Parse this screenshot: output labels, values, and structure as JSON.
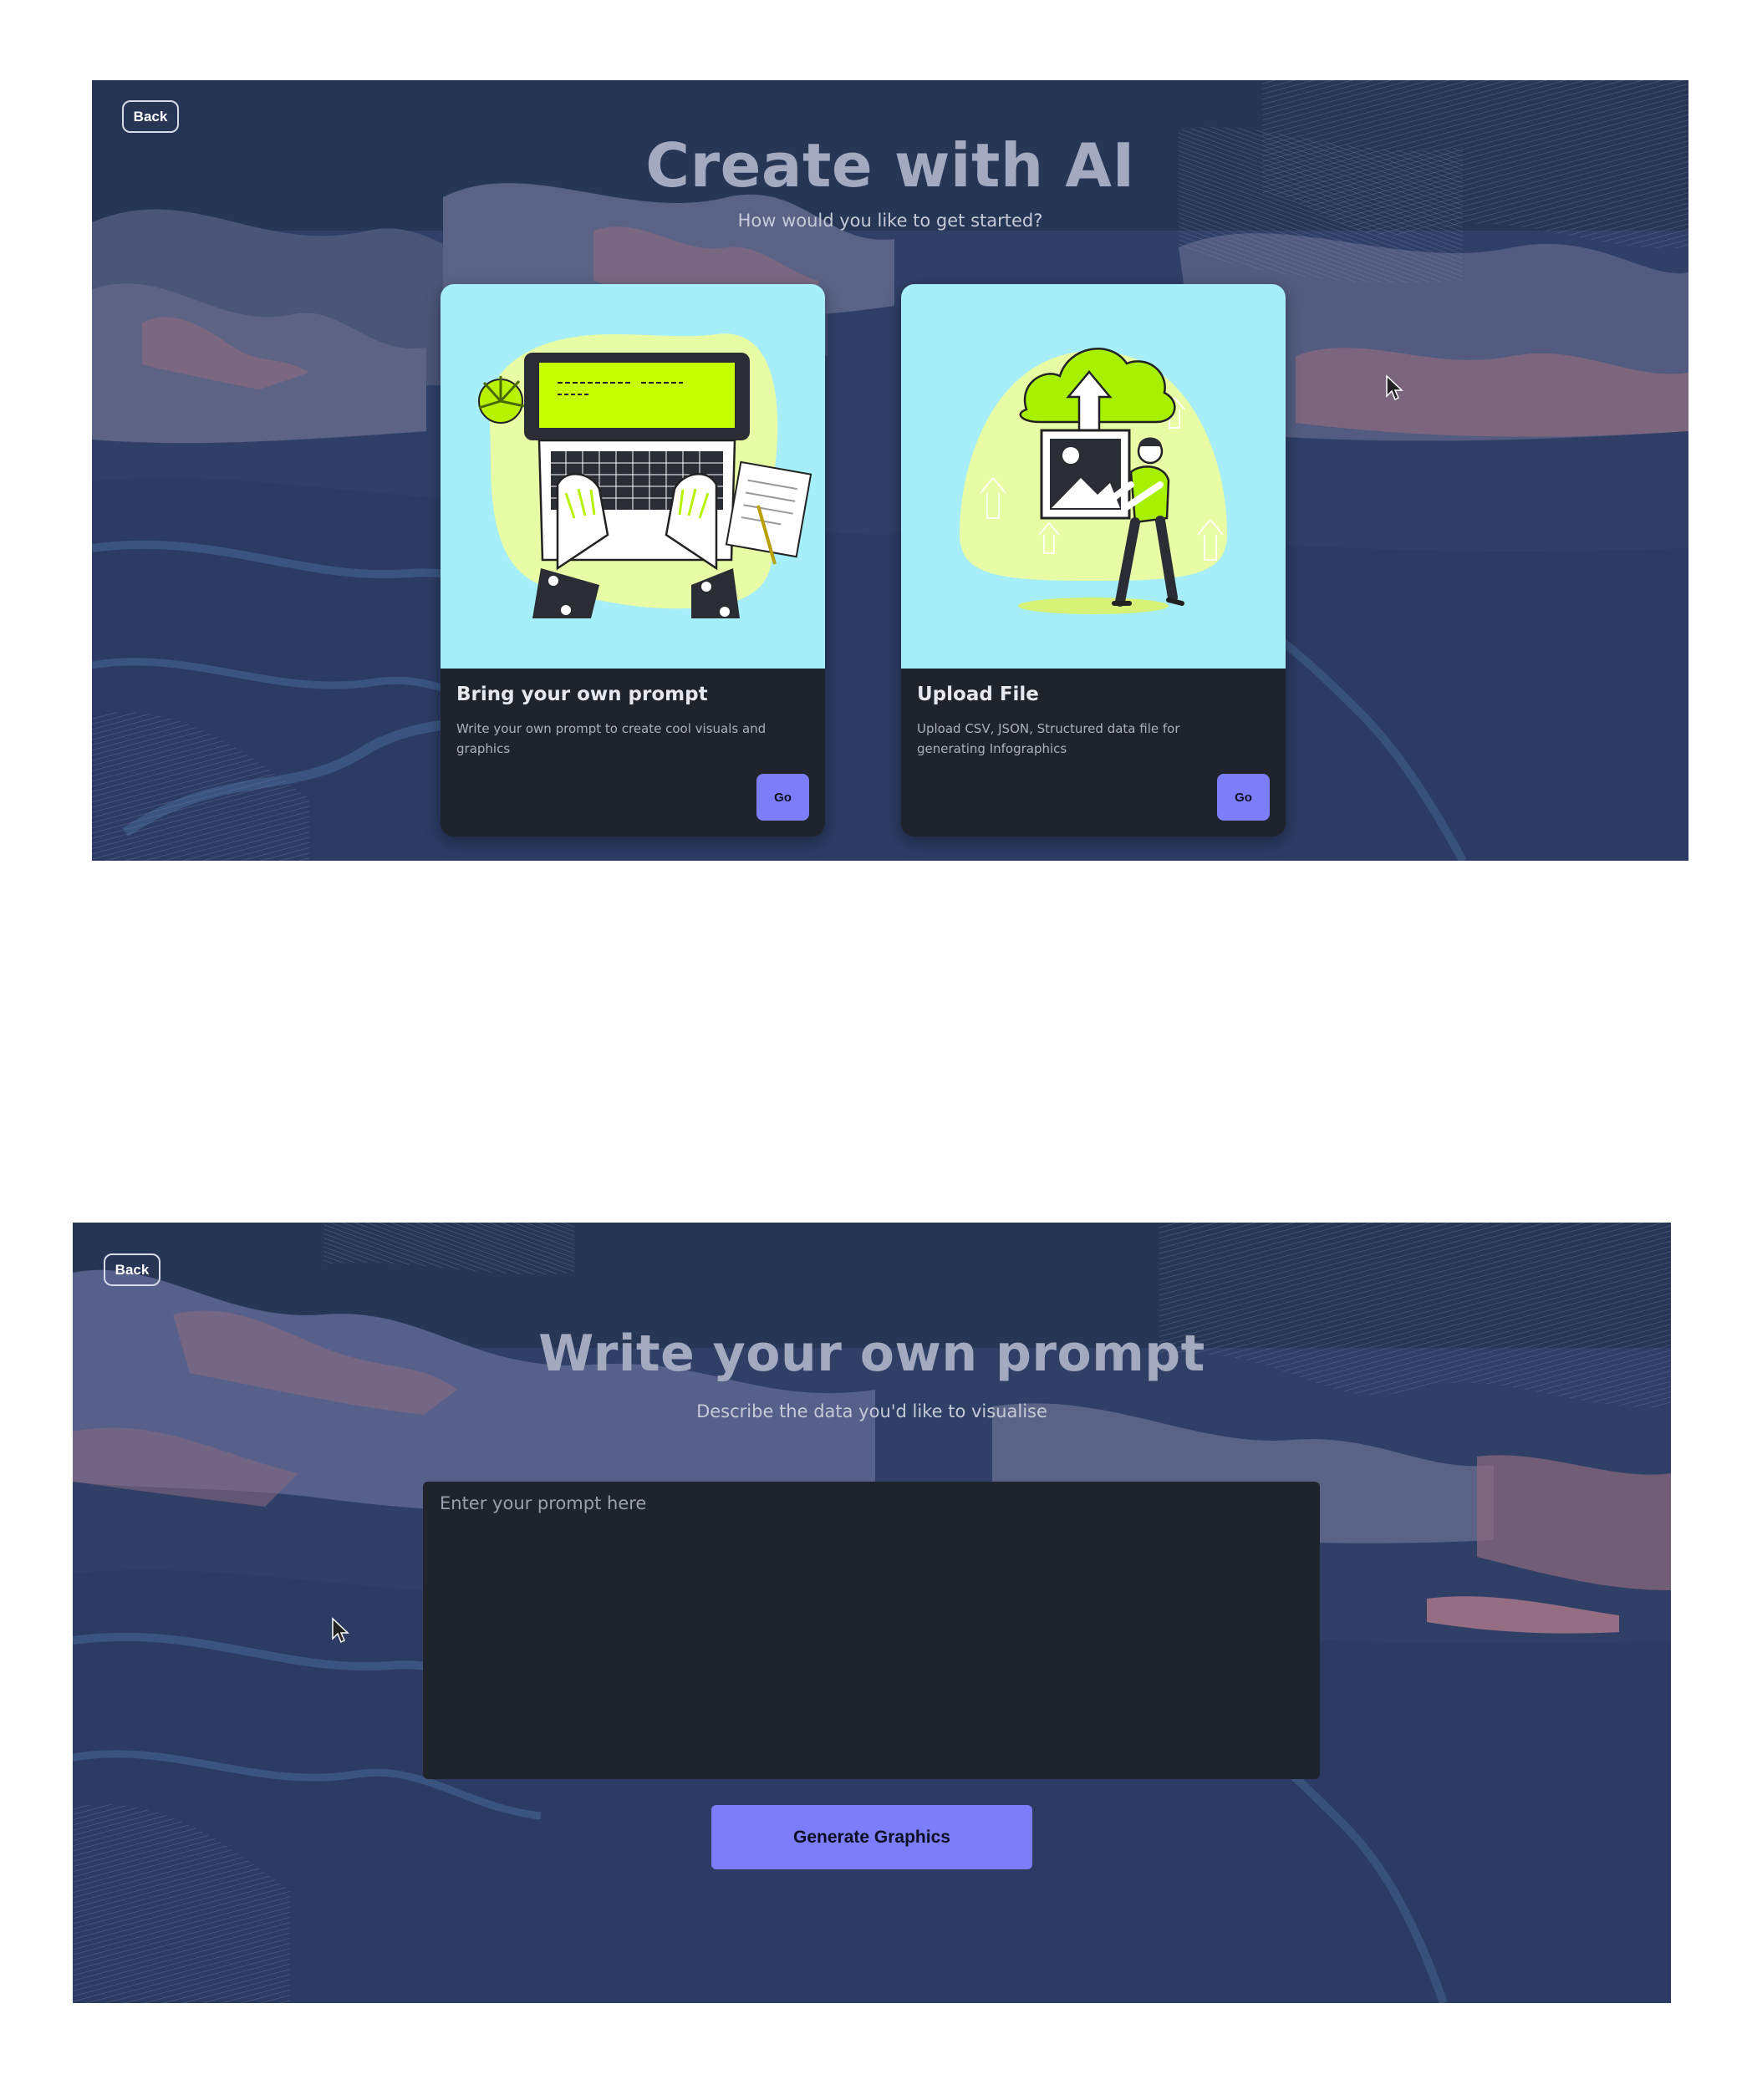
{
  "colors": {
    "background": "#2e3e63",
    "accent_button": "#7b7ef8",
    "card_bg": "#1f242c",
    "illustration_bg": "#a6eef9",
    "illustration_green": "#b9f200"
  },
  "screen1": {
    "back_label": "Back",
    "title": "Create with AI",
    "subtitle": "How would you like to get started?",
    "cards": [
      {
        "illustration": "laptop-typing-illustration",
        "title": "Bring your own prompt",
        "description": "Write your own prompt to create cool visuals and graphics",
        "button_label": "Go"
      },
      {
        "illustration": "cloud-upload-illustration",
        "title": "Upload File",
        "description": "Upload CSV, JSON, Structured data file for generating Infographics",
        "button_label": "Go"
      }
    ]
  },
  "screen2": {
    "back_label": "Back",
    "title": "Write your own prompt",
    "subtitle": "Describe the data you'd like to visualise",
    "prompt_placeholder": "Enter your prompt here",
    "prompt_value": "",
    "generate_label": "Generate Graphics"
  }
}
